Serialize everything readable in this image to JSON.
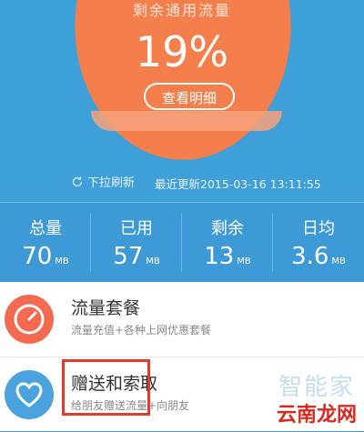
{
  "usage": {
    "remain_label": "剩余通用流量",
    "percent": "19%",
    "detail_button": "查看明细",
    "refresh_label": "下拉刷新",
    "updated_text": "最近更新2015-03-16 13:11:55"
  },
  "stats": [
    {
      "label": "总量",
      "value": "70",
      "unit": "MB"
    },
    {
      "label": "已用",
      "value": "57",
      "unit": "MB"
    },
    {
      "label": "剩余",
      "value": "13",
      "unit": "MB"
    },
    {
      "label": "日均",
      "value": "3.6",
      "unit": "MB"
    }
  ],
  "list": [
    {
      "title": "流量套餐",
      "subtitle": "流量充值+各种上网优惠套餐",
      "icon": "timer-icon",
      "color": "#f26a4f"
    },
    {
      "title": "赠送和索取",
      "subtitle": "给朋友赠送流量+向朋友",
      "icon": "heart-icon",
      "color": "#4aa3dc"
    }
  ],
  "watermark": {
    "top": "智能家",
    "bottom": "云南龙网"
  }
}
